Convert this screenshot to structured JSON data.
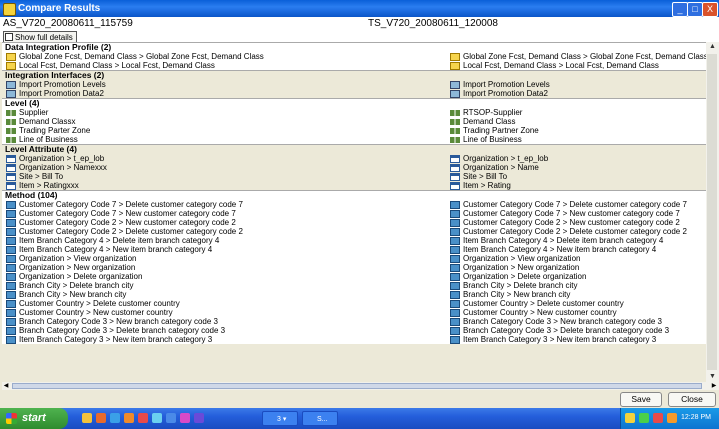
{
  "window": {
    "title": "Compare Results",
    "minimize": "_",
    "maximize": "□",
    "close": "X"
  },
  "columns": {
    "left": "AS_V720_20080611_115759",
    "right": "TS_V720_20080611_120008"
  },
  "toolbar": {
    "show_full_details": "Show full details",
    "show_full_checked": false
  },
  "sections": [
    {
      "title": "Data Integration Profile (2)",
      "icon": "folder-icon",
      "bg": "white",
      "rows": [
        [
          "Global Zone Fcst, Demand Class > Global Zone Fcst, Demand Class",
          "Global Zone Fcst, Demand Class > Global Zone Fcst, Demand Class"
        ],
        [
          "Local Fcst, Demand Class > Local Fcst, Demand Class",
          "Local Fcst, Demand Class > Local Fcst, Demand Class"
        ]
      ]
    },
    {
      "title": "Integration Interfaces (2)",
      "icon": "interface-icon",
      "bg": "gray",
      "rows": [
        [
          "Import Promotion Levels",
          "Import Promotion Levels"
        ],
        [
          "Import Promotion Data2",
          "Import Promotion Data2"
        ]
      ]
    },
    {
      "title": "Level (4)",
      "icon": "level-icon",
      "bg": "white",
      "rows": [
        [
          "Supplier",
          "RTSOP-Supplier"
        ],
        [
          "Demand Classx",
          "Demand Class"
        ],
        [
          "Trading Parter Zone",
          "Trading Partner Zone"
        ],
        [
          "Line of Business",
          "Line of Business"
        ]
      ]
    },
    {
      "title": "Level Attribute (4)",
      "icon": "attribute-icon",
      "bg": "gray",
      "rows": [
        [
          "Organization > t_ep_lob",
          "Organization > t_ep_lob"
        ],
        [
          "Organization > Namexxx",
          "Organization > Name"
        ],
        [
          "Site > Bill To",
          "Site > Bill To"
        ],
        [
          "Item > Ratingxxx",
          "Item > Rating"
        ]
      ]
    },
    {
      "title": "Method (104)",
      "icon": "method-icon",
      "bg": "white",
      "rows": [
        [
          "Customer Category Code 7 > Delete customer category code 7",
          "Customer Category Code 7 > Delete customer category code 7"
        ],
        [
          "Customer Category Code 7 > New customer category code 7",
          "Customer Category Code 7 > New customer category code 7"
        ],
        [
          "Customer Category Code 2 > New customer category code 2",
          "Customer Category Code 2 > New customer category code 2"
        ],
        [
          "Customer Category Code 2 > Delete customer category code 2",
          "Customer Category Code 2 > Delete customer category code 2"
        ],
        [
          "Item Branch Category 4 > Delete item branch category 4",
          "Item Branch Category 4 > Delete item branch category 4"
        ],
        [
          "Item Branch Category 4 > New item branch category 4",
          "Item Branch Category 4 > New item branch category 4"
        ],
        [
          "Organization > View organization",
          "Organization > View organization"
        ],
        [
          "Organization > New organization",
          "Organization > New organization"
        ],
        [
          "Organization > Delete organization",
          "Organization > Delete organization"
        ],
        [
          "Branch City > Delete branch city",
          "Branch City > Delete branch city"
        ],
        [
          "Branch City > New branch city",
          "Branch City > New branch city"
        ],
        [
          "Customer Country > Delete customer country",
          "Customer Country > Delete customer country"
        ],
        [
          "Customer Country > New customer country",
          "Customer Country > New customer country"
        ],
        [
          "Branch Category Code 3 > New branch category code 3",
          "Branch Category Code 3 > New branch category code 3"
        ],
        [
          "Branch Category Code 3 > Delete branch category code 3",
          "Branch Category Code 3 > Delete branch category code 3"
        ],
        [
          "Item Branch Category 3 > New item branch category 3",
          "Item Branch Category 3 > New item branch category 3"
        ]
      ]
    }
  ],
  "buttons": {
    "save": "Save",
    "close": "Close"
  },
  "taskbar": {
    "start": "start",
    "tasks": [
      {
        "label": "3 ▾",
        "icon": "window-group-icon"
      },
      {
        "label": "S...",
        "icon": "app-icon"
      }
    ],
    "clock": "12:28 PM"
  },
  "colors": {
    "titlebar": "#0a5fd8",
    "taskbar": "#245edb",
    "start": "#2e8b2e",
    "panel": "#ece9d8"
  }
}
